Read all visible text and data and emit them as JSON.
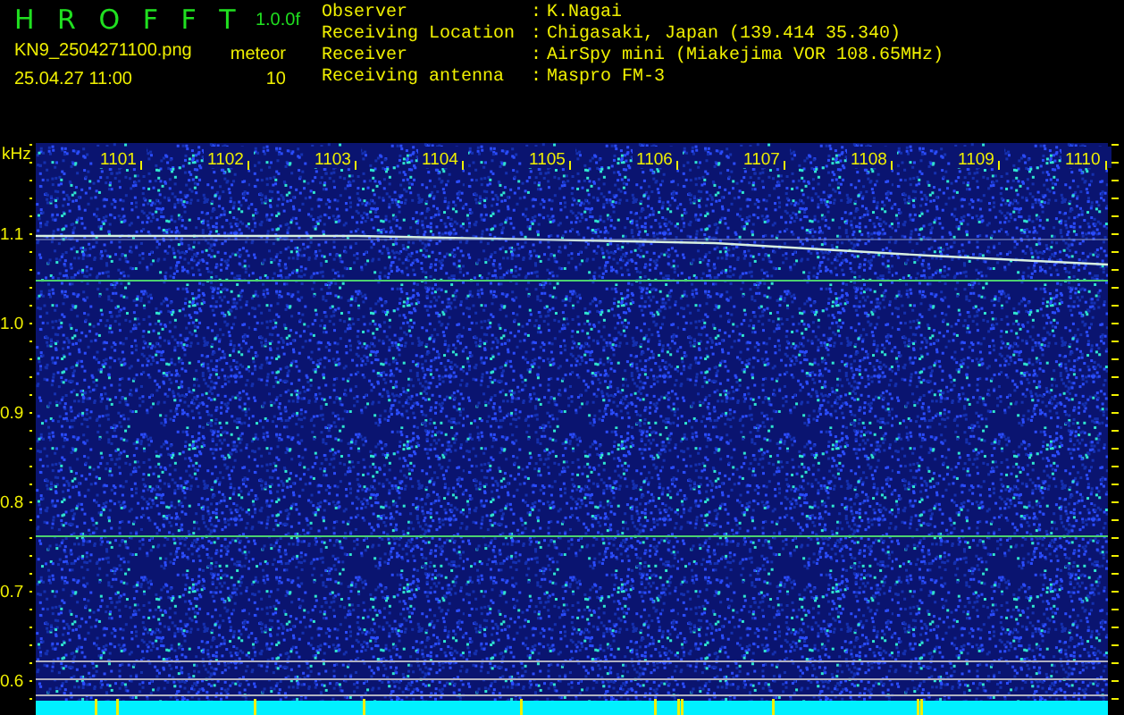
{
  "app": {
    "name": "H R O F F T",
    "version": "1.0.0f",
    "file": "KN9_2504271100.png",
    "datetime": "25.04.27 11:00",
    "mode_label": "meteor",
    "count": "10"
  },
  "station": [
    {
      "label": "Observer",
      "separator": ":",
      "value": "K.Nagai"
    },
    {
      "label": "Receiving Location",
      "separator": ":",
      "value": "Chigasaki, Japan (139.414 35.340)"
    },
    {
      "label": "Receiver",
      "separator": ":",
      "value": "AirSpy mini (Miakejima VOR 108.65MHz)"
    },
    {
      "label": "Receiving antenna",
      "separator": ":",
      "value": "Maspro FM-3"
    }
  ],
  "spectrogram": {
    "unit": "kHz",
    "time_labels": [
      "1101",
      "1102",
      "1103",
      "1104",
      "1105",
      "1106",
      "1107",
      "1108",
      "1109",
      "1110"
    ],
    "freq_labels": [
      "1.1",
      "1.0",
      "0.9",
      "0.8",
      "0.7",
      "0.6"
    ]
  }
}
